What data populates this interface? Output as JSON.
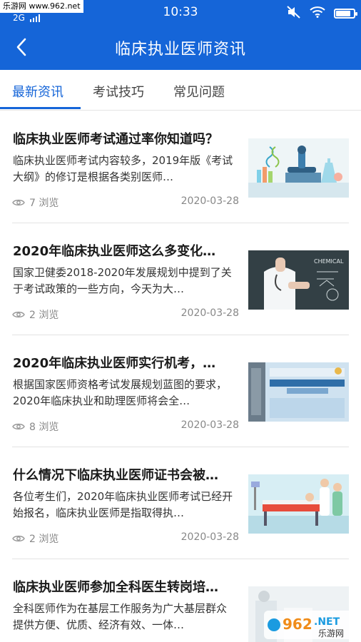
{
  "status_bar": {
    "watermark": "乐游网 www.962.net",
    "network": "2G",
    "time": "10:33",
    "battery_level": 0.9
  },
  "header": {
    "title": "临床执业医师资讯"
  },
  "tabs": [
    {
      "label": "最新资讯",
      "active": true
    },
    {
      "label": "考试技巧",
      "active": false
    },
    {
      "label": "常见问题",
      "active": false
    }
  ],
  "articles": [
    {
      "title": "临床执业医师考试通过率你知道吗？",
      "summary": "临床执业医师考试内容较多，2019年版《考试大纲》的修订是根据各类别医师…",
      "views": "7 浏览",
      "date": "2020-03-28",
      "thumb": "lab-equipment-illustration"
    },
    {
      "title": "2020年临床执业医师这么多变化…",
      "summary": "国家卫健委2018-2020年发展规划中提到了关于考试政策的一些方向，今天为大…",
      "views": "2 浏览",
      "date": "2020-03-28",
      "thumb": "doctor-chalkboard-photo"
    },
    {
      "title": "2020年临床执业医师实行机考，…",
      "summary": "根据国家医师资格考试发展规划蓝图的要求，2020年临床执业和助理医师将会全…",
      "views": "8 浏览",
      "date": "2020-03-28",
      "thumb": "exam-book-cover"
    },
    {
      "title": "什么情况下临床执业医师证书会被…",
      "summary": "各位考生们，2020年临床执业医师考试已经开始报名，临床执业医师是指取得执…",
      "views": "2 浏览",
      "date": "2020-03-28",
      "thumb": "hospital-bed-illustration"
    },
    {
      "title": "临床执业医师参加全科医生转岗培…",
      "summary": "全科医师作为在基层工作服务为广大基层群众提供方便、优质、经济有效、一体…",
      "views": "",
      "date": "",
      "thumb": "clinic-photo"
    }
  ],
  "watermark_bottom": {
    "brand": "962",
    "suffix": ".NET",
    "caption": "乐游网"
  },
  "colors": {
    "primary": "#1565d8",
    "divider": "#e3e3e3",
    "meta_text": "#888888"
  }
}
